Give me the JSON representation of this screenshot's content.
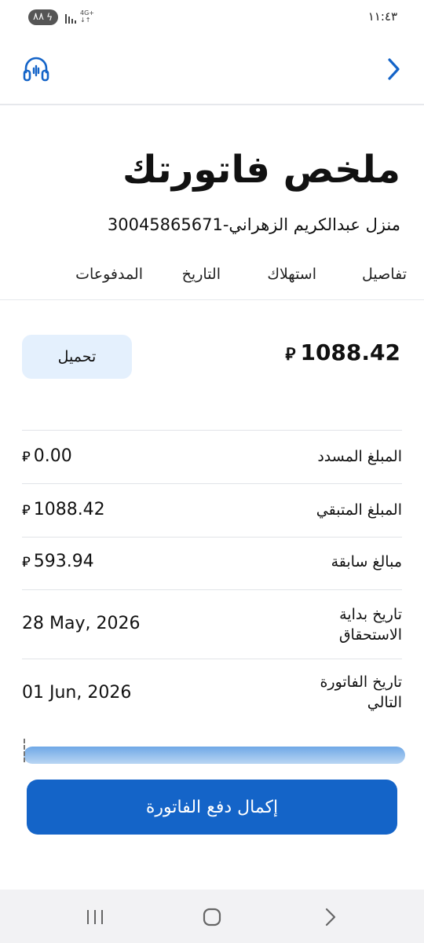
{
  "status_bar": {
    "time": "١١:٤٣",
    "battery": "٨٨",
    "network_top": "4G+",
    "network_bottom": "↓↑"
  },
  "header": {
    "title": "ملخص فاتورتك",
    "account": "منزل عبدالكريم الزهراني-30045865671"
  },
  "tabs": [
    {
      "label": "تفاصيل"
    },
    {
      "label": "استهلاك"
    },
    {
      "label": "التاريخ"
    },
    {
      "label": "المدفوعات"
    }
  ],
  "summary": {
    "total": "1088.42",
    "currency_symbol": "⃁",
    "download_label": "تحميل"
  },
  "rows": [
    {
      "label": "المبلغ المسدد",
      "value": "0.00",
      "currency": "⃁"
    },
    {
      "label": "المبلغ المتبقي",
      "value": "1088.42",
      "currency": "⃁"
    },
    {
      "label": "مبالغ سابقة",
      "value": "593.94",
      "currency": "⃁"
    },
    {
      "label": "تاريخ بداية الاستحقاق",
      "value": "28 May, 2026",
      "currency": ""
    },
    {
      "label": "تاريخ الفاتورة التالي",
      "value": "01 Jun, 2026",
      "currency": ""
    }
  ],
  "progress": {
    "fraction": 1.0
  },
  "pay_button": {
    "label": "إكمال دفع الفاتورة"
  },
  "colors": {
    "primary": "#1464c8",
    "download_bg": "#e4f0fd",
    "divider": "#e1e4e8"
  },
  "icons": {
    "back": "chevron-right-icon",
    "support": "headset-icon",
    "nav_recent": "recent-apps-icon",
    "nav_home": "home-icon",
    "nav_back": "chevron-right-icon"
  }
}
